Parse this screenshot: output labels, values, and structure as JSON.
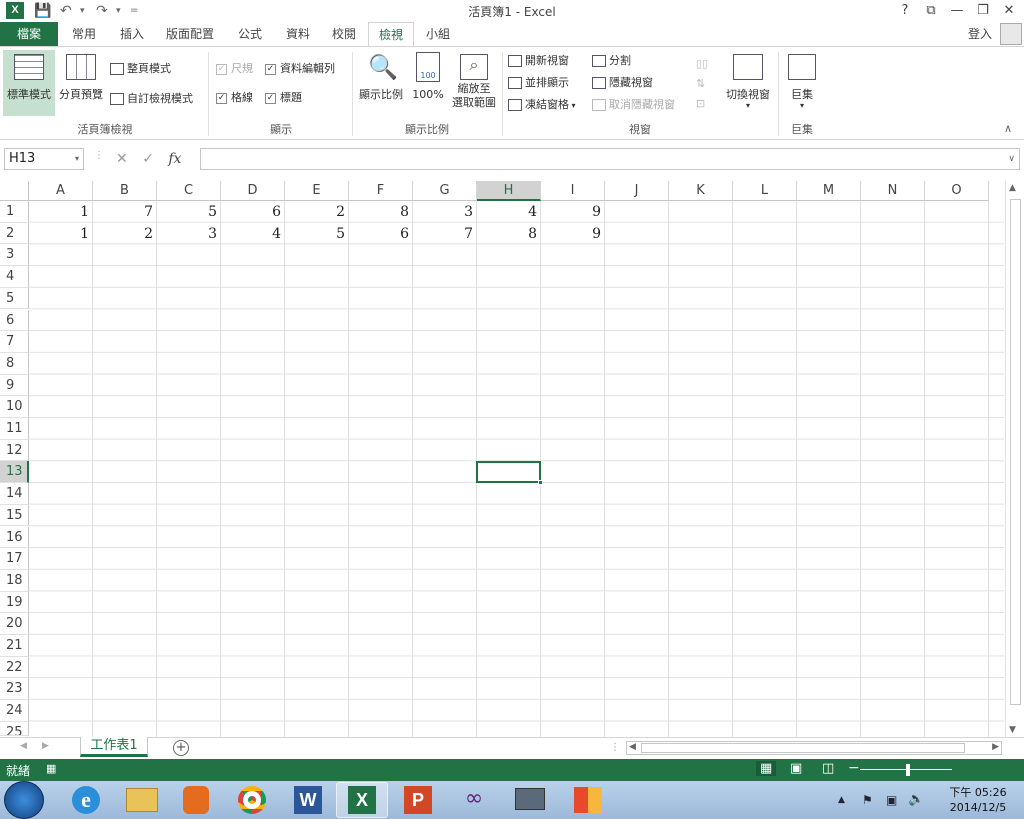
{
  "window": {
    "title": "活頁簿1 - Excel",
    "app_icon": "X",
    "help": "?",
    "restore_ribbon": "⧉",
    "minimize": "—",
    "maximize": "❐",
    "close": "✕"
  },
  "quick_access": {
    "save": "save-icon",
    "undo": "undo-icon",
    "redo": "redo-icon",
    "customize": "="
  },
  "tabs": [
    "檔案",
    "常用",
    "插入",
    "版面配置",
    "公式",
    "資料",
    "校閱",
    "檢視",
    "小組"
  ],
  "signin": "登入",
  "ribbon": {
    "workbook_views": {
      "normal": "標準模式",
      "page_break": "分頁預覽",
      "page_layout": "整頁模式",
      "custom_views": "自訂檢視模式",
      "group_label": "活頁簿檢視"
    },
    "show": {
      "ruler": "尺規",
      "formula_bar": "資料編輯列",
      "gridlines": "格線",
      "headings": "標題",
      "group_label": "顯示"
    },
    "zoom": {
      "zoom": "顯示比例",
      "p100": "100%",
      "zoom_sel_1": "縮放至",
      "zoom_sel_2": "選取範圍",
      "group_label": "顯示比例"
    },
    "window": {
      "new_window": "開新視窗",
      "arrange_all": "並排顯示",
      "freeze_panes": "凍結窗格",
      "split": "分割",
      "hide": "隱藏視窗",
      "unhide": "取消隱藏視窗",
      "switch": "切換視窗",
      "group_label": "視窗"
    },
    "macros": {
      "label": "巨集",
      "group_label": "巨集"
    }
  },
  "formula_bar": {
    "name_box": "H13",
    "cancel": "✕",
    "enter": "✓",
    "fx": "fx",
    "content": ""
  },
  "columns": [
    "A",
    "B",
    "C",
    "D",
    "E",
    "F",
    "G",
    "H",
    "I",
    "J",
    "K",
    "L",
    "M",
    "N",
    "O"
  ],
  "selected_column": "H",
  "rows": [
    "1",
    "2",
    "3",
    "4",
    "5",
    "6",
    "7",
    "8",
    "9",
    "10",
    "11",
    "12",
    "13",
    "14",
    "15",
    "16",
    "17",
    "18",
    "19",
    "20",
    "21",
    "22",
    "23",
    "24",
    "25"
  ],
  "selected_row": "13",
  "cells": {
    "row1": [
      "1",
      "7",
      "5",
      "6",
      "2",
      "8",
      "3",
      "4",
      "9"
    ],
    "row2": [
      "1",
      "2",
      "3",
      "4",
      "5",
      "6",
      "7",
      "8",
      "9"
    ]
  },
  "sheet": {
    "name": "工作表1",
    "add": "+"
  },
  "status": {
    "ready": "就緒"
  },
  "taskbar": {
    "time": "下午 05:26",
    "date": "2014/12/5"
  },
  "colors": {
    "accent": "#217346",
    "taskbar": "#9db9d9"
  }
}
